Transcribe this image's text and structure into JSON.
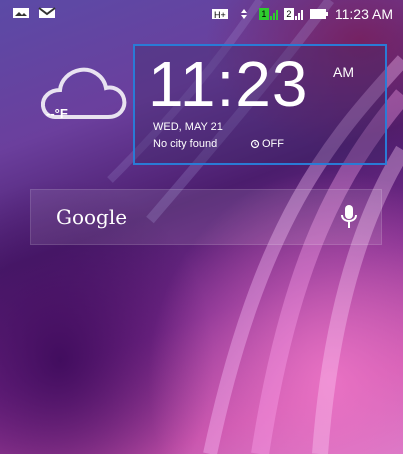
{
  "status_bar": {
    "time": "11:23 AM",
    "left_icons": [
      "photo-icon",
      "gmail-icon"
    ],
    "right_icons": [
      "hplus-icon",
      "data-arrows-icon",
      "sim1-signal-icon",
      "sim2-signal-icon",
      "battery-icon"
    ],
    "sim1_label": "1",
    "sim2_label": "2"
  },
  "weather": {
    "temperature": "--°F",
    "icon": "cloud-icon"
  },
  "clock": {
    "time": "11:23",
    "ampm": "AM",
    "date": "WED, MAY 21",
    "city": "No city found",
    "alarm": "OFF"
  },
  "search": {
    "logo_text": "Google",
    "mic_icon": "mic-icon"
  }
}
